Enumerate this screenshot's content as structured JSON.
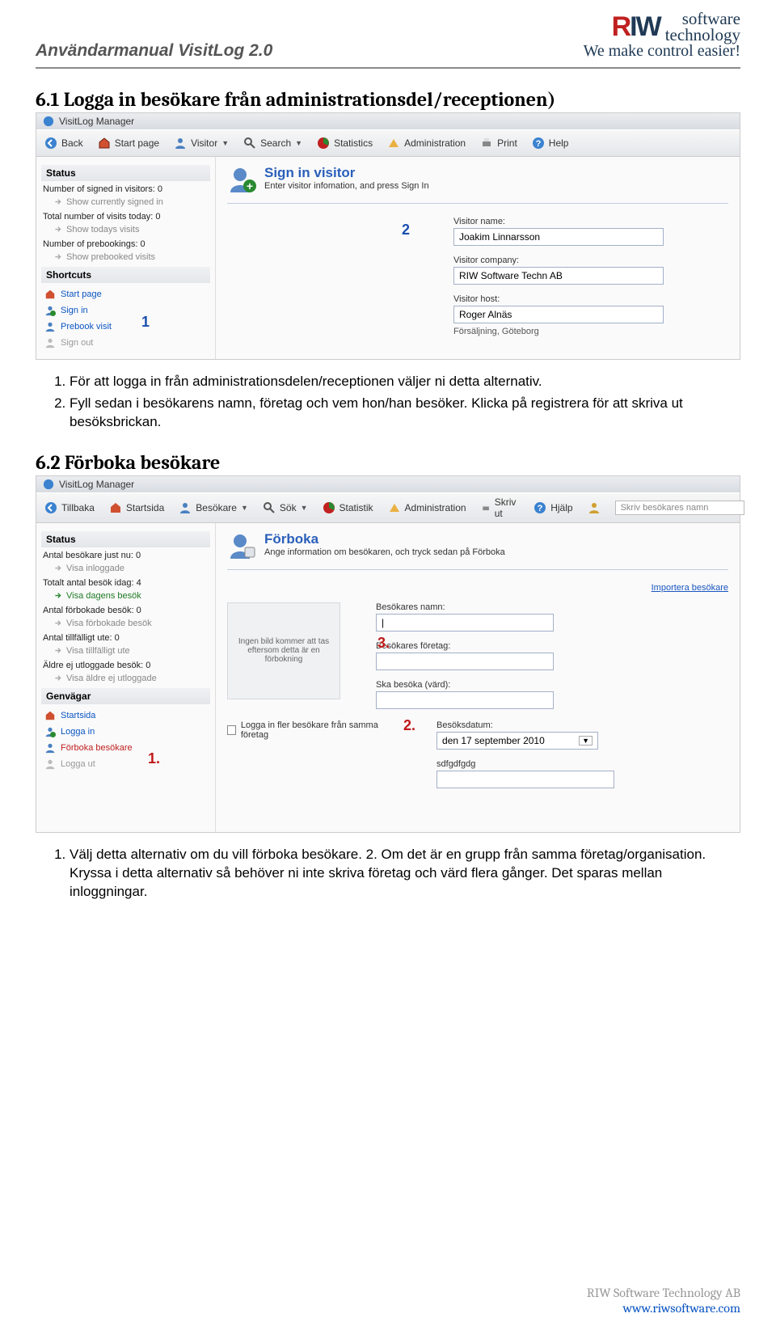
{
  "header": {
    "doc_title": "Användarmanual VisitLog 2.0",
    "logo_text": "software\ntechnology",
    "tagline": "We make control easier!"
  },
  "section1": {
    "heading": "6.1  Logga in besökare från administrationsdel/receptionen)",
    "app_title": "VisitLog Manager",
    "toolbar": [
      "Back",
      "Start page",
      "Visitor",
      "Search",
      "Statistics",
      "Administration",
      "Print",
      "Help"
    ],
    "status_title": "Status",
    "status_lines": [
      {
        "main": "Number of signed in visitors: 0",
        "sub": "Show currently signed in"
      },
      {
        "main": "Total number of visits today: 0",
        "sub": "Show todays visits"
      },
      {
        "main": "Number of prebookings: 0",
        "sub": "Show prebooked visits"
      }
    ],
    "shortcuts_title": "Shortcuts",
    "shortcuts": [
      "Start page",
      "Sign in",
      "Prebook visit",
      "Sign out"
    ],
    "main_title": "Sign in visitor",
    "main_desc": "Enter visitor infomation, and press Sign In",
    "labels": {
      "name": "Visitor name:",
      "company": "Visitor company:",
      "host": "Visitor host:"
    },
    "values": {
      "name": "Joakim Linnarsson",
      "company": "RIW Software Techn AB",
      "host": "Roger Alnäs"
    },
    "sub_note": "Försäljning, Göteborg",
    "annot1": "1",
    "annot2": "2",
    "below": [
      "För att logga in från administrationsdelen/receptionen väljer ni detta alternativ.",
      "Fyll sedan i besökarens namn, företag och vem hon/han besöker. Klicka på registrera för att skriva ut besöksbrickan."
    ]
  },
  "section2": {
    "heading": "6.2  Förboka besökare",
    "app_title": "VisitLog Manager",
    "toolbar": [
      "Tillbaka",
      "Startsida",
      "Besökare",
      "Sök",
      "Statistik",
      "Administration",
      "Skriv ut",
      "Hjälp"
    ],
    "search_placeholder": "Skriv besökares namn",
    "status_title": "Status",
    "status_lines": [
      {
        "main": "Antal besökare just nu: 0",
        "sub": "Visa inloggade",
        "active": false
      },
      {
        "main": "Totalt antal besök idag: 4",
        "sub": "Visa dagens besök",
        "active": true
      },
      {
        "main": "Antal förbokade besök: 0",
        "sub": "Visa förbokade besök",
        "active": false
      },
      {
        "main": "Antal tillfälligt ute: 0",
        "sub": "Visa tillfälligt ute",
        "active": false
      },
      {
        "main": "Äldre ej utloggade besök: 0",
        "sub": "Visa äldre ej utloggade",
        "active": false
      }
    ],
    "shortcuts_title": "Genvägar",
    "shortcuts": [
      "Startsida",
      "Logga in",
      "Förboka besökare",
      "Logga ut"
    ],
    "main_title": "Förboka",
    "main_desc": "Ange information om besökaren, och tryck sedan på Förboka",
    "import_link": "Importera besökare",
    "img_text": "Ingen bild kommer att tas eftersom detta är en förbokning",
    "labels": {
      "name": "Besökares namn:",
      "company": "Besökares företag:",
      "host": "Ska besöka (värd):",
      "date": "Besöksdatum:"
    },
    "cb_label": "Logga in fler besökare från samma företag",
    "date_value": "den 17 september 2010",
    "extra_field": "sdfgdfgdg",
    "annot1": "1.",
    "annot2": "2.",
    "annot3": "3.",
    "below": [
      "Välj detta alternativ om du vill förboka besökare. 2. Om det är en grupp från samma företag/organisation. Kryssa i detta alternativ så behöver ni inte skriva företag och värd flera gånger. Det sparas mellan inloggningar."
    ]
  },
  "footer": {
    "company": "RIW Software Technology AB",
    "link": "www.riwsoftware.com"
  }
}
